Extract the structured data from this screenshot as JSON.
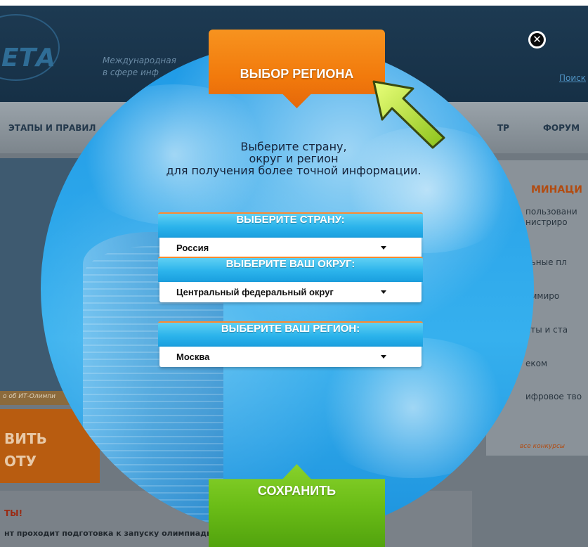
{
  "background": {
    "logo_text": "ЕТА",
    "tagline_line1": "Международная",
    "tagline_line2": "в сфере инф",
    "search_link": "Поиск",
    "nav": {
      "item1": "ЭТАПЫ И ПРАВИЛ",
      "item2": "ТР",
      "item3": "ФОРУМ"
    },
    "right_panel": {
      "heading": "МИНАЦИ",
      "item1_line1": "пользовани",
      "item1_line2": "нистриро",
      "item2": "льные пл",
      "item3": "аммиро",
      "item4": "кты и ста",
      "item5": "еком",
      "item6": "ифровое тво",
      "all_link": "все конкурсы"
    },
    "left_strip": "о об ИТ-Олимпи",
    "orange_line1": "ВИТЬ",
    "orange_line2": "ОТУ",
    "news_title": "ТЫ!",
    "news_text": "нт проходит подготовка к запуску олимпиады"
  },
  "modal": {
    "title": "ВЫБОР РЕГИОНА",
    "close_icon": "close-icon",
    "instructions_line1": "Выберите страну,",
    "instructions_line2": "округ и регион",
    "instructions_line3": "для получения более точной информации.",
    "country": {
      "label": "ВЫБЕРИТЕ СТРАНУ:",
      "value": "Россия"
    },
    "district": {
      "label": "ВЫБЕРИТЕ ВАШ ОКРУГ:",
      "value": "Центральный федеральный округ"
    },
    "region": {
      "label": "ВЫБЕРИТЕ ВАШ РЕГИОН:",
      "value": "Москва"
    },
    "save_label": "СОХРАНИТЬ"
  },
  "colors": {
    "title_orange": "#f27a0c",
    "save_green": "#6bbd17",
    "select_header_blue": "#2bb3eb",
    "circle_blue": "#2ca6ea"
  }
}
